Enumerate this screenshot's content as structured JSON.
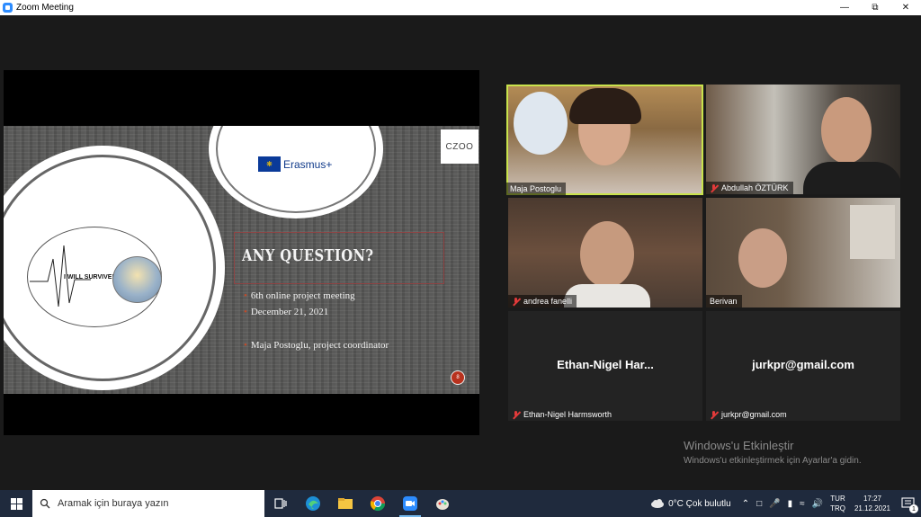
{
  "window": {
    "title": "Zoom Meeting"
  },
  "slide": {
    "erasmus_label": "Erasmus+",
    "logo_text": "CZOO",
    "survive_text": "I WILL SURVIVE!",
    "question": "ANY QUESTION?",
    "bullets": [
      "6th online project meeting",
      "December 21, 2021",
      "Maja Postoglu, project coordinator"
    ],
    "page_number": "8"
  },
  "participants": [
    {
      "name": "Maja Postoglu",
      "muted": false,
      "active_speaker": true
    },
    {
      "name": "Abdullah ÖZTÜRK",
      "muted": true
    },
    {
      "name": "andrea fanelli",
      "muted": true
    },
    {
      "name": "Berivan",
      "muted": false
    },
    {
      "name": "Ethan-Nigel Harmsworth",
      "display_text": "Ethan-Nigel  Har...",
      "muted": true
    },
    {
      "name": "jurkpr@gmail.com",
      "display_text": "jurkpr@gmail.com",
      "muted": true
    }
  ],
  "activation": {
    "title": "Windows'u Etkinleştir",
    "subtitle": "Windows'u etkinleştirmek için Ayarlar'a gidin."
  },
  "taskbar": {
    "search_placeholder": "Aramak için buraya yazın",
    "weather": "0°C  Çok bulutlu",
    "lang_top": "TUR",
    "lang_bottom": "TRQ",
    "time": "17:27",
    "date": "21.12.2021",
    "notification_count": "1"
  },
  "colors": {
    "active_speaker": "#c9e34c",
    "muted": "#e23a3a",
    "taskbar": "#1f2a3d"
  }
}
